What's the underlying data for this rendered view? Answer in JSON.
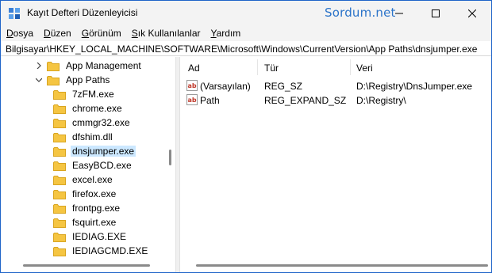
{
  "window": {
    "title": "Kayıt Defteri Düzenleyicisi",
    "watermark": "Sordum.net"
  },
  "menu": [
    {
      "label": "Dosya"
    },
    {
      "label": "Düzen"
    },
    {
      "label": "Görünüm"
    },
    {
      "label": "Sık Kullanılanlar"
    },
    {
      "label": "Yardım"
    }
  ],
  "address": "Bilgisayar\\HKEY_LOCAL_MACHINE\\SOFTWARE\\Microsoft\\Windows\\CurrentVersion\\App Paths\\dnsjumper.exe",
  "tree": [
    {
      "label": "App Management",
      "chevron": "right"
    },
    {
      "label": "App Paths",
      "chevron": "down"
    },
    {
      "label": "7zFM.exe"
    },
    {
      "label": "chrome.exe"
    },
    {
      "label": "cmmgr32.exe"
    },
    {
      "label": "dfshim.dll"
    },
    {
      "label": "dnsjumper.exe",
      "selected": true
    },
    {
      "label": "EasyBCD.exe"
    },
    {
      "label": "excel.exe"
    },
    {
      "label": "firefox.exe"
    },
    {
      "label": "frontpg.exe"
    },
    {
      "label": "fsquirt.exe"
    },
    {
      "label": "IEDIAG.EXE"
    },
    {
      "label": "IEDIAGCMD.EXE"
    }
  ],
  "columns": {
    "name": "Ad",
    "type": "Tür",
    "data": "Veri"
  },
  "values": [
    {
      "name": "(Varsayılan)",
      "type": "REG_SZ",
      "data": "D:\\Registry\\DnsJumper.exe"
    },
    {
      "name": "Path",
      "type": "REG_EXPAND_SZ",
      "data": "D:\\Registry\\"
    }
  ],
  "colors": {
    "accent": "#1f64c8",
    "selection": "#cce8ff",
    "folder": "#f5c542",
    "watermark": "#2a73c9"
  }
}
